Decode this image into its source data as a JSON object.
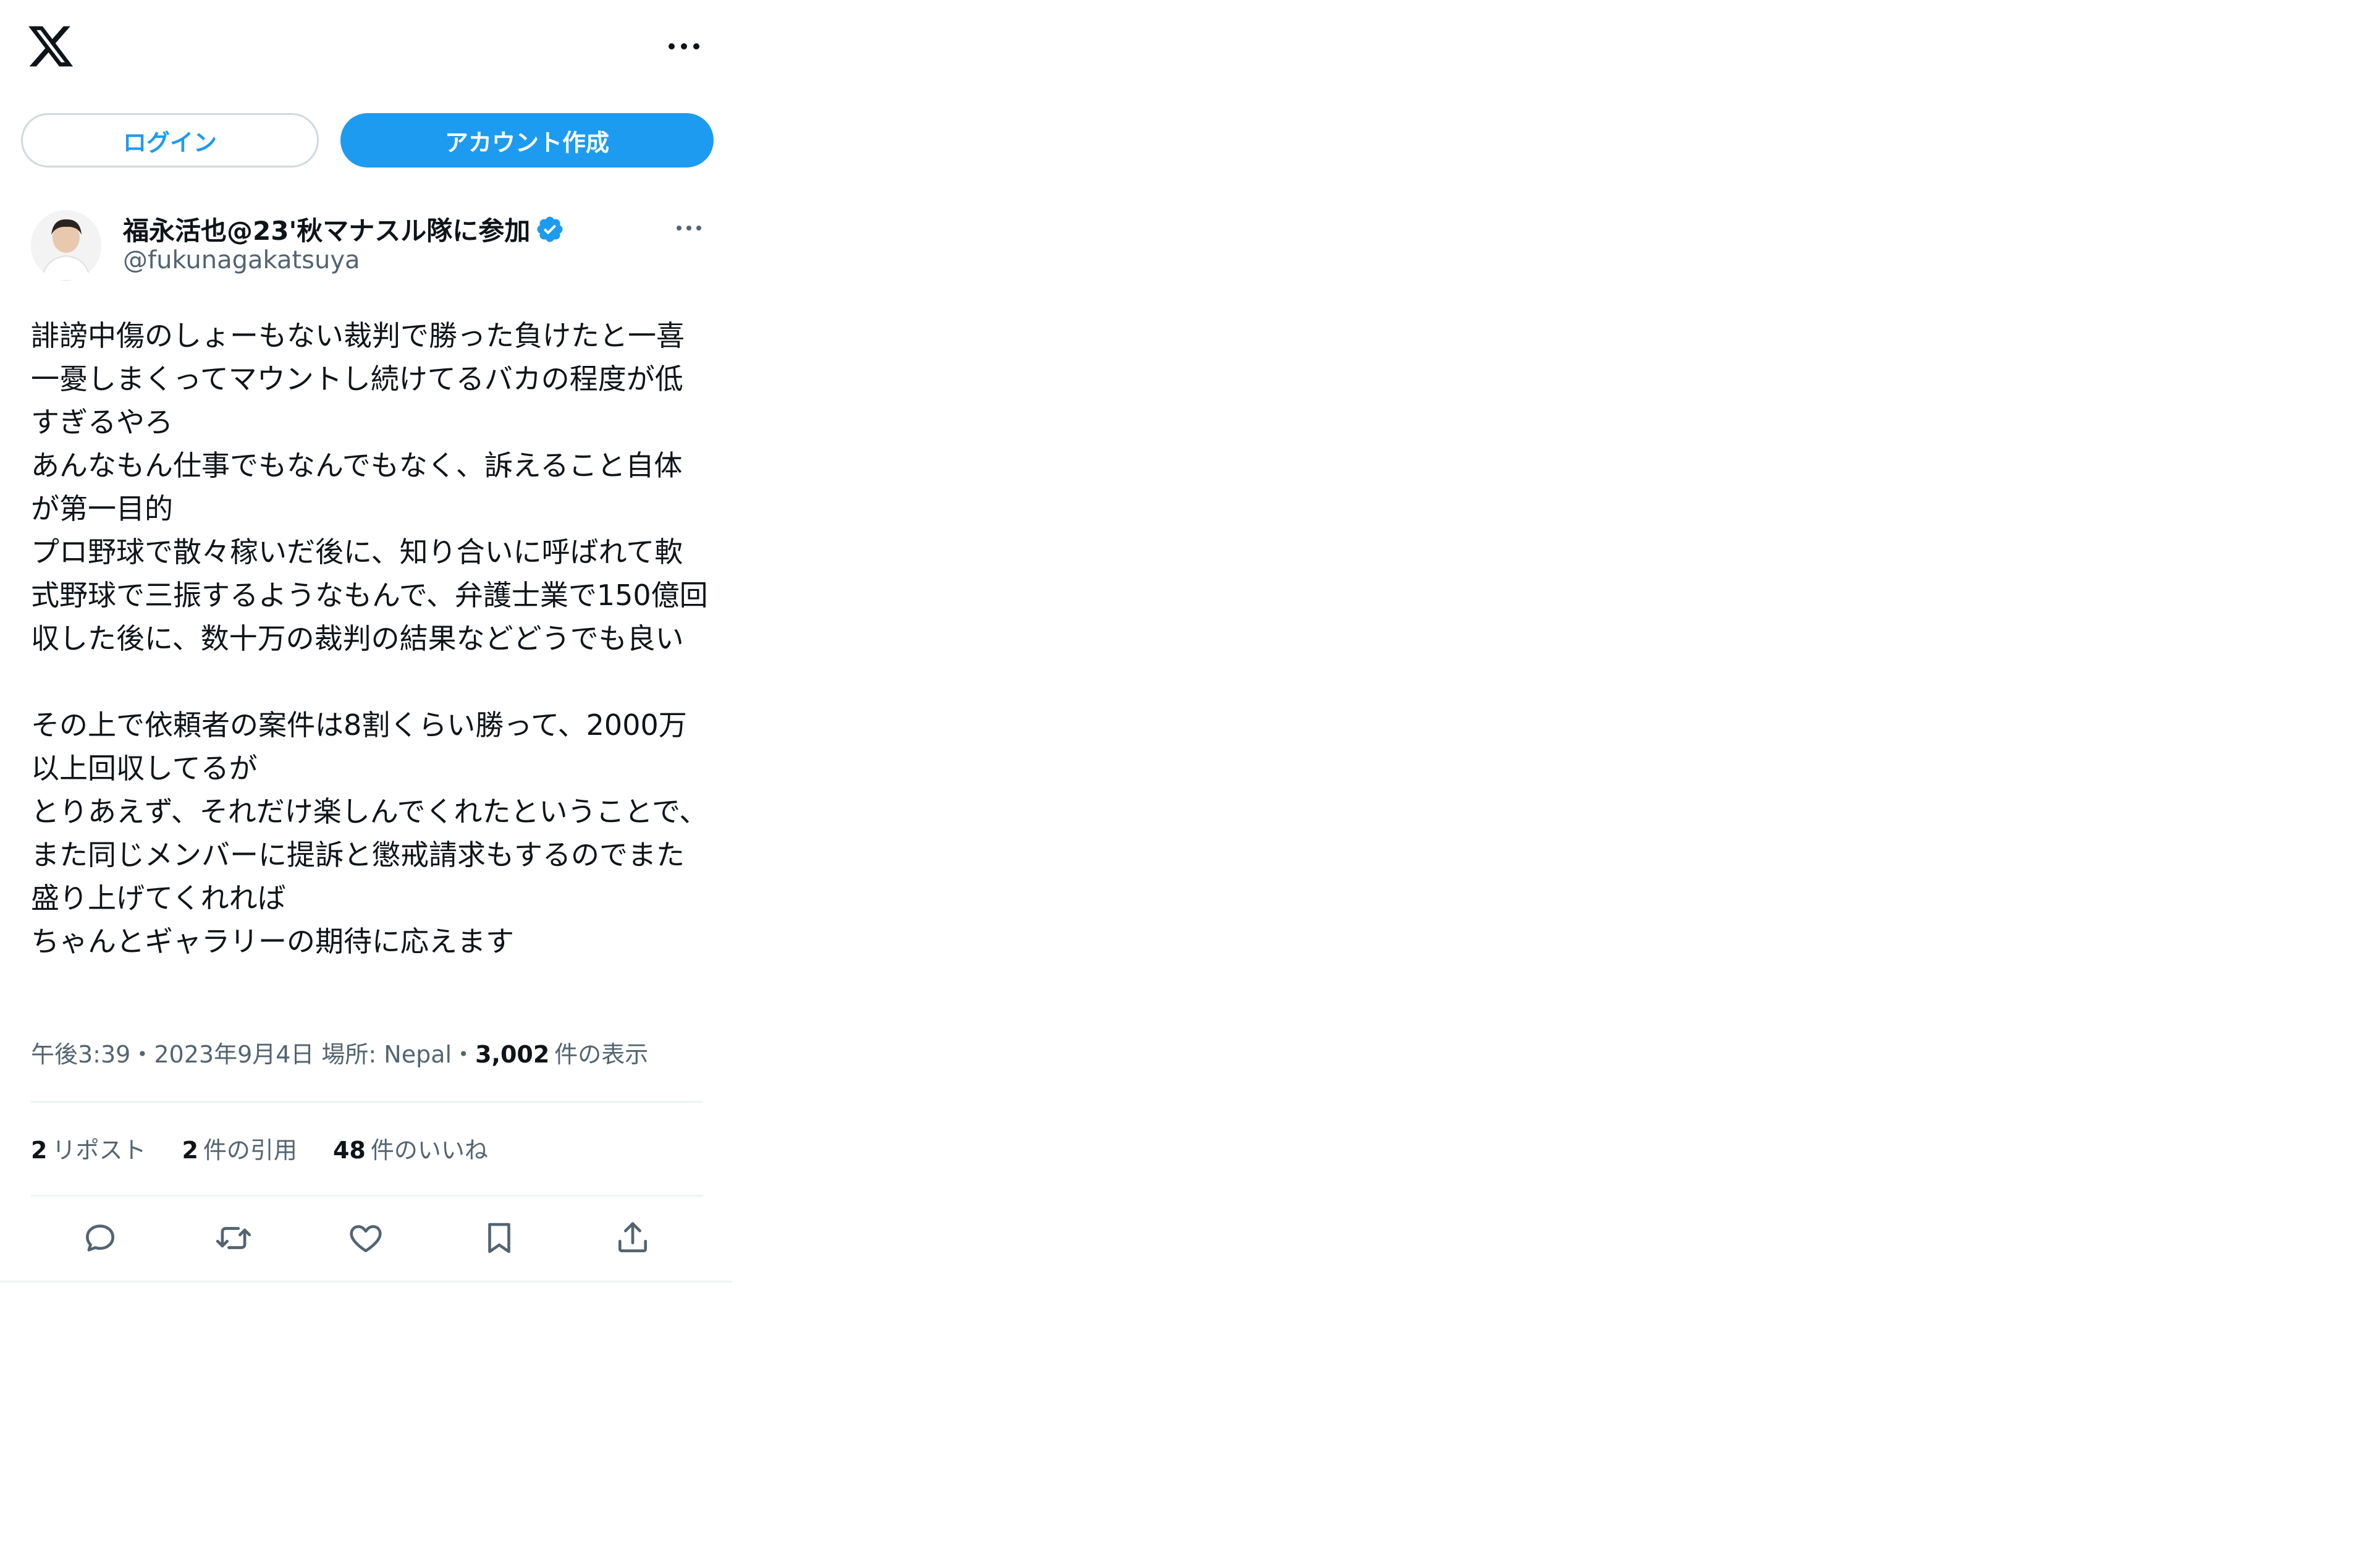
{
  "header": {
    "logo_icon": "x-logo-icon",
    "more_icon": "more-horizontal-icon"
  },
  "auth": {
    "login_label": "ログイン",
    "signup_label": "アカウント作成"
  },
  "author": {
    "display_name": "福永活也@23'秋マナスル隊に参加",
    "handle": "@fukunagakatsuya",
    "verified_icon": "verified-badge-icon"
  },
  "tweet": {
    "text": "誹謗中傷のしょーもない裁判で勝った負けたと一喜一憂しまくってマウントし続けてるバカの程度が低すぎるやろ\nあんなもん仕事でもなんでもなく、訴えること自体が第一目的\nプロ野球で散々稼いだ後に、知り合いに呼ばれて軟式野球で三振するようなもんで、弁護士業で150億回収した後に、数十万の裁判の結果などどうでも良い\n\nその上で依頼者の案件は8割くらい勝って、2000万以上回収してるが\nとりあえず、それだけ楽しんでくれたということで、また同じメンバーに提訴と懲戒請求もするのでまた盛り上げてくれれば\nちゃんとギャラリーの期待に応えます"
  },
  "meta": {
    "time": "午後3:39",
    "dot1": "・",
    "date": "2023年9月4日",
    "location": "場所: Nepal",
    "dot2": "・",
    "views_count": "3,002",
    "views_label": "件の表示"
  },
  "stats": {
    "reposts_count": "2",
    "reposts_label": "リポスト",
    "quotes_count": "2",
    "quotes_label": "件の引用",
    "likes_count": "48",
    "likes_label": "件のいいね"
  },
  "actions": {
    "reply_icon": "reply-icon",
    "retweet_icon": "retweet-icon",
    "like_icon": "heart-icon",
    "bookmark_icon": "bookmark-icon",
    "share_icon": "share-icon"
  },
  "colors": {
    "accent": "#1d9bf0",
    "text_primary": "#0f1419",
    "text_secondary": "#536471",
    "border": "#eff3f4"
  }
}
